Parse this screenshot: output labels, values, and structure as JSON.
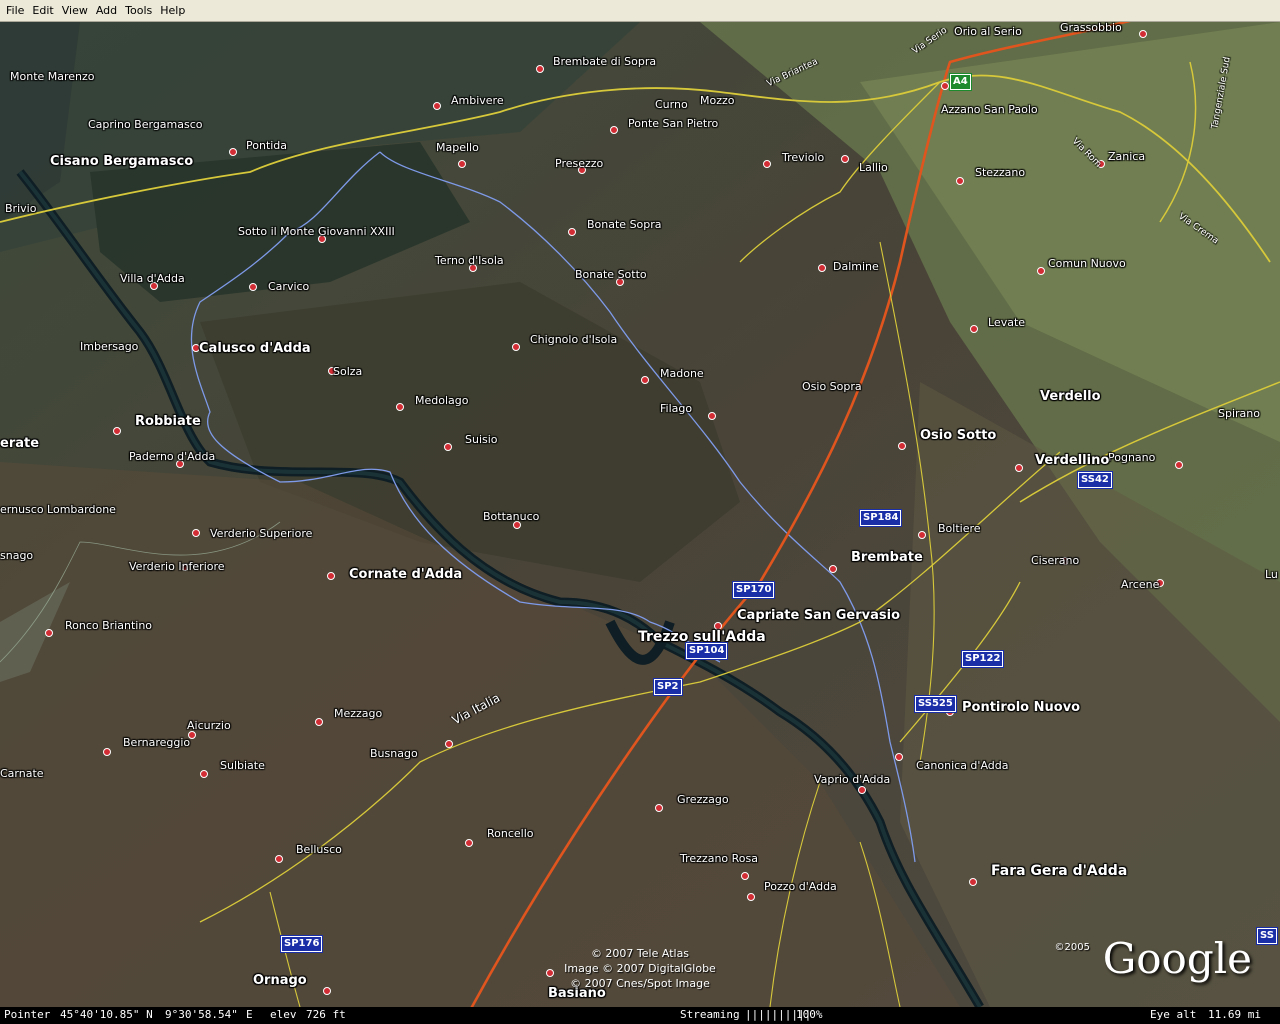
{
  "menu": [
    "File",
    "Edit",
    "View",
    "Add",
    "Tools",
    "Help"
  ],
  "places": [
    {
      "name": "Monte Marenzo",
      "size": "small"
    },
    {
      "name": "Caprino Bergamasco",
      "size": "small"
    },
    {
      "name": "Cisano Bergamasco",
      "size": "mid"
    },
    {
      "name": "Pontida",
      "size": "small"
    },
    {
      "name": "Brivio",
      "size": "small"
    },
    {
      "name": "Ambivere",
      "size": "small"
    },
    {
      "name": "Mapello",
      "size": "small"
    },
    {
      "name": "Brembate di Sopra",
      "size": "small"
    },
    {
      "name": "Curno",
      "size": "small"
    },
    {
      "name": "Mozzo",
      "size": "small"
    },
    {
      "name": "Ponte San Pietro",
      "size": "small"
    },
    {
      "name": "Presezzo",
      "size": "small"
    },
    {
      "name": "Orio al Serio",
      "size": "small"
    },
    {
      "name": "Grassobbio",
      "size": "small"
    },
    {
      "name": "Azzano San Paolo",
      "size": "small"
    },
    {
      "name": "Treviolo",
      "size": "small"
    },
    {
      "name": "Lallio",
      "size": "small"
    },
    {
      "name": "Stezzano",
      "size": "small"
    },
    {
      "name": "Zanica",
      "size": "small"
    },
    {
      "name": "Sotto il Monte Giovanni XXIII",
      "size": "small"
    },
    {
      "name": "Bonate Sopra",
      "size": "small"
    },
    {
      "name": "Terno d'Isola",
      "size": "small"
    },
    {
      "name": "Bonate Sotto",
      "size": "small"
    },
    {
      "name": "Villa d'Adda",
      "size": "small"
    },
    {
      "name": "Carvico",
      "size": "small"
    },
    {
      "name": "Dalmine",
      "size": "small"
    },
    {
      "name": "Comun Nuovo",
      "size": "small"
    },
    {
      "name": "Levate",
      "size": "small"
    },
    {
      "name": "Imbersago",
      "size": "small"
    },
    {
      "name": "Calusco d'Adda",
      "size": "mid"
    },
    {
      "name": "Chignolo d'Isola",
      "size": "small"
    },
    {
      "name": "Solza",
      "size": "small"
    },
    {
      "name": "Madone",
      "size": "small"
    },
    {
      "name": "Osio Sopra",
      "size": "small"
    },
    {
      "name": "Medolago",
      "size": "small"
    },
    {
      "name": "Filago",
      "size": "small"
    },
    {
      "name": "Verdello",
      "size": "mid"
    },
    {
      "name": "Spirano",
      "size": "small"
    },
    {
      "name": "Robbiate",
      "size": "mid"
    },
    {
      "name": "Osio Sotto",
      "size": "mid"
    },
    {
      "name": "erate",
      "size": "mid"
    },
    {
      "name": "Suisio",
      "size": "small"
    },
    {
      "name": "Paderno d'Adda",
      "size": "small"
    },
    {
      "name": "Pognano",
      "size": "small"
    },
    {
      "name": "Verdellino",
      "size": "mid"
    },
    {
      "name": "ernusco Lombardone",
      "size": "small"
    },
    {
      "name": "Bottanuco",
      "size": "small"
    },
    {
      "name": "Boltiere",
      "size": "small"
    },
    {
      "name": "Verderio Superiore",
      "size": "small"
    },
    {
      "name": "Brembate",
      "size": "mid"
    },
    {
      "name": "Ciserano",
      "size": "small"
    },
    {
      "name": "snago",
      "size": "small"
    },
    {
      "name": "Verderio Inferiore",
      "size": "small"
    },
    {
      "name": "Cornate d'Adda",
      "size": "mid"
    },
    {
      "name": "Arcene",
      "size": "small"
    },
    {
      "name": "Lu",
      "size": "small"
    },
    {
      "name": "Capriate San Gervasio",
      "size": "mid"
    },
    {
      "name": "Ronco Briantino",
      "size": "small"
    },
    {
      "name": "Trezzo sull'Adda",
      "size": "big"
    },
    {
      "name": "Pontirolo Nuovo",
      "size": "mid"
    },
    {
      "name": "Mezzago",
      "size": "small"
    },
    {
      "name": "Aicurzio",
      "size": "small"
    },
    {
      "name": "Bernareggio",
      "size": "small"
    },
    {
      "name": "Busnago",
      "size": "small"
    },
    {
      "name": "Canonica d'Adda",
      "size": "small"
    },
    {
      "name": "Sulbiate",
      "size": "small"
    },
    {
      "name": "Carnate",
      "size": "small"
    },
    {
      "name": "Vaprio d'Adda",
      "size": "small"
    },
    {
      "name": "Grezzago",
      "size": "small"
    },
    {
      "name": "Roncello",
      "size": "small"
    },
    {
      "name": "Bellusco",
      "size": "small"
    },
    {
      "name": "Trezzano Rosa",
      "size": "small"
    },
    {
      "name": "Fara Gera d'Adda",
      "size": "big"
    },
    {
      "name": "Pozzo d'Adda",
      "size": "small"
    },
    {
      "name": "Ornago",
      "size": "mid"
    },
    {
      "name": "Basiano",
      "size": "mid"
    }
  ],
  "shields": [
    {
      "label": "A4",
      "color": "green"
    },
    {
      "label": "SP184",
      "color": "blue"
    },
    {
      "label": "SP170",
      "color": "blue"
    },
    {
      "label": "SP104",
      "color": "blue"
    },
    {
      "label": "SP122",
      "color": "blue"
    },
    {
      "label": "SP2",
      "color": "blue"
    },
    {
      "label": "SS525",
      "color": "blue"
    },
    {
      "label": "SS42",
      "color": "blue"
    },
    {
      "label": "SP176",
      "color": "blue"
    },
    {
      "label": "SS",
      "color": "blue"
    }
  ],
  "streets": [
    "Via Italia",
    "Via Briantea",
    "Via Serio",
    "Via Rom",
    "Via Crema",
    "Tangenziale Sud"
  ],
  "copyright": [
    "© 2007 Tele Atlas",
    "Image © 2007 DigitalGlobe",
    "© 2007 Cnes/Spot Image"
  ],
  "logo": {
    "text": "Google",
    "year": "©2005"
  },
  "status": {
    "pointer_label": "Pointer",
    "lat": "45°40'10.85\" N",
    "lon": "9°30'58.54\"",
    "lon_dir": "E",
    "elev_label": "elev",
    "elev": "726 ft",
    "streaming_label": "Streaming",
    "streaming_bar": "||||||||||",
    "streaming_pct": "100%",
    "eye_label": "Eye  alt",
    "eye_alt": "11.69 mi"
  }
}
